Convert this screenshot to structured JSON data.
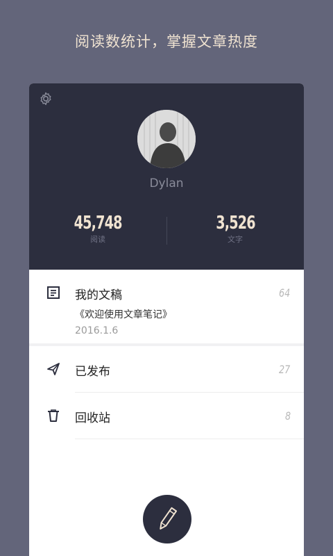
{
  "tagline": "阅读数统计，掌握文章热度",
  "profile": {
    "username": "Dylan",
    "stats": [
      {
        "value": "45,748",
        "label": "阅读"
      },
      {
        "value": "3,526",
        "label": "文字"
      }
    ]
  },
  "list": {
    "drafts": {
      "title": "我的文稿",
      "count": "64",
      "latest_title": "《欢迎使用文章笔记》",
      "latest_date": "2016.1.6"
    },
    "published": {
      "title": "已发布",
      "count": "27"
    },
    "trash": {
      "title": "回收站",
      "count": "8"
    }
  },
  "icons": {
    "settings": "gear-icon",
    "drafts": "document-icon",
    "published": "paper-plane-icon",
    "trash": "trash-icon",
    "compose": "pen-icon"
  },
  "colors": {
    "background": "#63657a",
    "header": "#2c2e3e",
    "accent_text": "#f0e3d1"
  }
}
